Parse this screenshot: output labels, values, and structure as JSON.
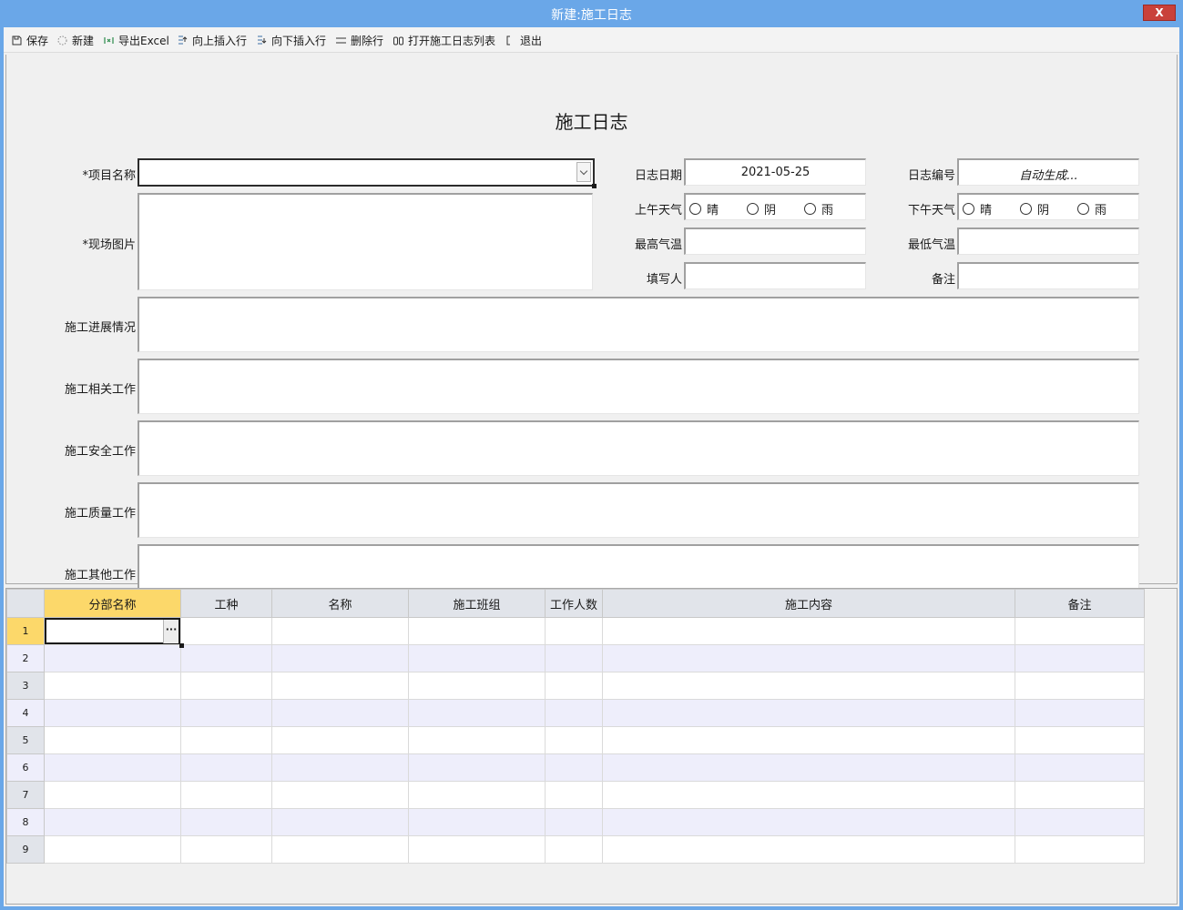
{
  "window": {
    "title": "新建:施工日志",
    "close_label": "X"
  },
  "toolbar": {
    "items": [
      {
        "label": "保存",
        "icon": "save-icon"
      },
      {
        "label": "新建",
        "icon": "new-icon"
      },
      {
        "label": "导出Excel",
        "icon": "excel-icon"
      },
      {
        "label": "向上插入行",
        "icon": "insert-above-icon"
      },
      {
        "label": "向下插入行",
        "icon": "insert-below-icon"
      },
      {
        "label": "删除行",
        "icon": "delete-row-icon"
      },
      {
        "label": "打开施工日志列表",
        "icon": "binoculars-icon"
      },
      {
        "label": "退出",
        "icon": "exit-icon"
      }
    ]
  },
  "form": {
    "title": "施工日志",
    "project_name_label": "*项目名称",
    "project_name_value": "",
    "site_photo_label": "*现场图片",
    "log_date_label": "日志日期",
    "log_date_value": "2021-05-25",
    "log_number_label": "日志编号",
    "log_number_value": "自动生成...",
    "am_weather_label": "上午天气",
    "pm_weather_label": "下午天气",
    "weather_options": [
      "晴",
      "阴",
      "雨"
    ],
    "max_temp_label": "最高气温",
    "min_temp_label": "最低气温",
    "writer_label": "填写人",
    "remark_label": "备注",
    "progress_label": "施工进展情况",
    "related_work_label": "施工相关工作",
    "safety_work_label": "施工安全工作",
    "quality_work_label": "施工质量工作",
    "other_work_label": "施工其他工作"
  },
  "grid": {
    "columns": [
      "分部名称",
      "工种",
      "名称",
      "施工班组",
      "工作人数",
      "施工内容",
      "备注"
    ],
    "active_column": "分部名称",
    "row_numbers": [
      "1",
      "2",
      "3",
      "4",
      "5",
      "6",
      "7",
      "8",
      "9"
    ],
    "ellipsis_label": "···"
  },
  "colors": {
    "titlebar": "#6aa7e8",
    "close_button": "#c9413a",
    "active_header": "#fcd86a",
    "alt_row": "#eeeefb",
    "header_bg": "#e1e4ea"
  }
}
